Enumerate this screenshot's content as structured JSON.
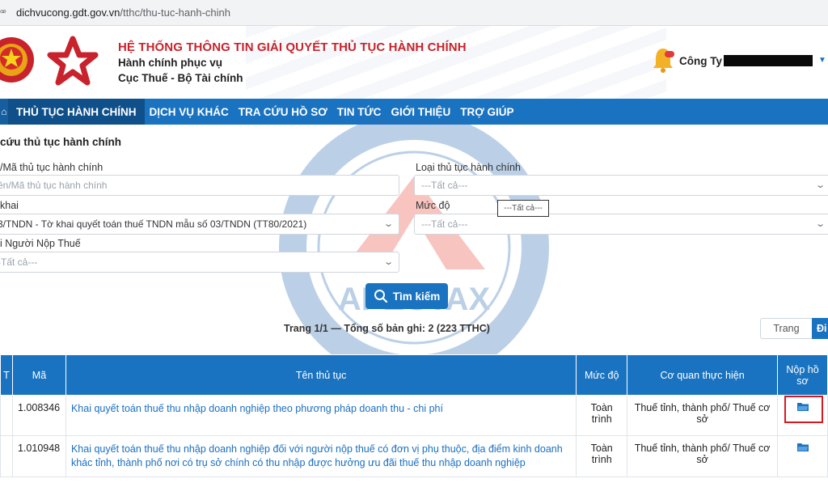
{
  "browser": {
    "url_host": "dichvucong.gdt.gov.vn",
    "url_path": "/tthc/thu-tuc-hanh-chinh"
  },
  "header": {
    "title": "HỆ THỐNG THÔNG TIN GIẢI QUYẾT THỦ TỤC HÀNH CHÍNH",
    "subtitle1": "Hành chính phục vụ",
    "subtitle2": "Cục Thuế - Bộ Tài chính",
    "user_label": "Công Ty"
  },
  "nav": {
    "items": [
      "THỦ TỤC HÀNH CHÍNH",
      "DỊCH VỤ KHÁC",
      "TRA CỨU HỒ SƠ",
      "TIN TỨC",
      "GIỚI THIỆU",
      "TRỢ GIÚP"
    ]
  },
  "form": {
    "title": "cứu thủ tục hành chính",
    "name_label": "/Mã thủ tục hành chính",
    "name_placeholder": "ên/Mã thủ tục hành chính",
    "type_label": "Loại thủ tục hành chính",
    "type_value": "---Tất cả---",
    "declaration_label": "khai",
    "declaration_value": "3/TNDN - Tờ khai quyết toán thuế TNDN mẫu số 03/TNDN (TT80/2021)",
    "level_label": "Mức độ",
    "level_value": "---Tất cả---",
    "level_tooltip": "---Tất cả---",
    "taxpayer_label": "i Người Nộp Thuế",
    "taxpayer_value": "-Tất cả---",
    "search_button": "Tìm kiếm"
  },
  "results": {
    "summary": "Trang 1/1 — Tổng số bản ghi: 2 (223 TTHC)",
    "page_input": "Trang",
    "go_button": "Đi"
  },
  "table": {
    "headers": [
      "T",
      "Mã",
      "Tên thủ tục",
      "Mức độ",
      "Cơ quan thực hiện",
      "Nộp hồ sơ"
    ],
    "rows": [
      {
        "code": "1.008346",
        "name": "Khai quyết toán thuế thu nhập doanh nghiệp theo phương pháp doanh thu - chi phí",
        "level": "Toàn trình",
        "agency": "Thuế tỉnh, thành phố/ Thuế cơ sở"
      },
      {
        "code": "1.010948",
        "name": "Khai quyết toán thuế thu nhập doanh nghiệp đối với người nộp thuế có đơn vị phụ thuộc, địa điểm kinh doanh khác tỉnh, thành phố nơi có trụ sở chính có thu nhập được hưởng ưu đãi thuế thu nhập doanh nghiệp",
        "level": "Toàn trình",
        "agency": "Thuế tỉnh, thành phố/ Thuế cơ sở"
      }
    ]
  },
  "watermark": {
    "text": "APECTAX"
  },
  "colors": {
    "primary": "#1a73c0",
    "title_red": "#c8232c",
    "highlight": "#d7191f"
  }
}
